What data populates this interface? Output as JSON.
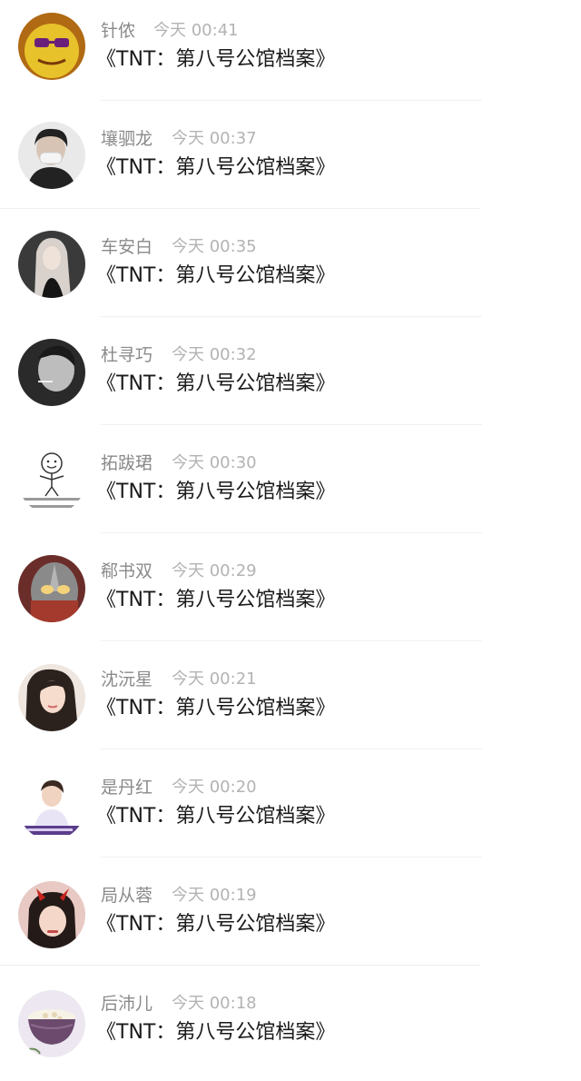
{
  "messages": [
    {
      "name": "针侬",
      "time": "今天 00:41",
      "text": "《TNT：第八号公馆档案》",
      "avatar": "yellow-cartoon-avatar",
      "avatar_colors": [
        "#e7c22a",
        "#b06a14"
      ]
    },
    {
      "name": "壤驷龙",
      "time": "今天 00:37",
      "text": "《TNT：第八号公馆档案》",
      "avatar": "masked-person-avatar",
      "avatar_colors": [
        "#e9e9e9",
        "#222222"
      ]
    },
    {
      "name": "车安白",
      "time": "今天 00:35",
      "text": "《TNT：第八号公馆档案》",
      "avatar": "long-hair-girl-avatar",
      "avatar_colors": [
        "#3a3a3a",
        "#d9d2cc"
      ]
    },
    {
      "name": "杜寻巧",
      "time": "今天 00:32",
      "text": "《TNT：第八号公馆档案》",
      "avatar": "bw-portrait-avatar",
      "avatar_colors": [
        "#2a2a2a",
        "#bdbdbd"
      ]
    },
    {
      "name": "拓跋珺",
      "time": "今天 00:30",
      "text": "《TNT：第八号公馆档案》",
      "avatar": "smiley-doodle-avatar",
      "avatar_colors": [
        "#ffffff",
        "#333333"
      ]
    },
    {
      "name": "郗书双",
      "time": "今天 00:29",
      "text": "《TNT：第八号公馆档案》",
      "avatar": "hero-helmet-avatar",
      "avatar_colors": [
        "#6b2d2a",
        "#d9a36b"
      ]
    },
    {
      "name": "沈沅星",
      "time": "今天 00:21",
      "text": "《TNT：第八号公馆档案》",
      "avatar": "woman-portrait-avatar",
      "avatar_colors": [
        "#efe6e0",
        "#2b211d"
      ]
    },
    {
      "name": "是丹红",
      "time": "今天 00:20",
      "text": "《TNT：第八号公馆档案》",
      "avatar": "young-man-avatar",
      "avatar_colors": [
        "#ffffff",
        "#5a3d8c"
      ]
    },
    {
      "name": "局从蓉",
      "time": "今天 00:19",
      "text": "《TNT：第八号公馆档案》",
      "avatar": "devil-horns-avatar",
      "avatar_colors": [
        "#e8c9c4",
        "#c8241e"
      ]
    },
    {
      "name": "后沛儿",
      "time": "今天 00:18",
      "text": "《TNT：第八号公馆档案》",
      "avatar": "rice-bowl-avatar",
      "avatar_colors": [
        "#ece7f0",
        "#6b4a6e"
      ]
    }
  ]
}
